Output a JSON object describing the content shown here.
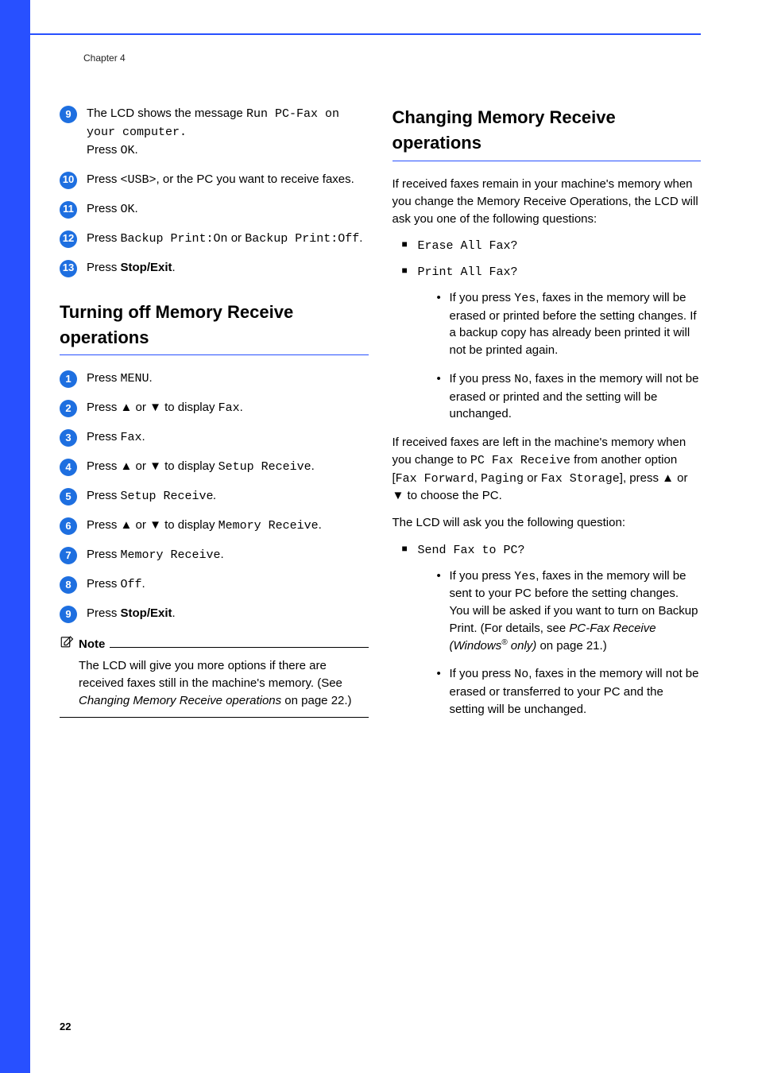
{
  "chapterLabel": "Chapter 4",
  "pageNumber": "22",
  "left": {
    "steps9_13": {
      "s9_a": "The LCD shows the message",
      "s9_run": "Run PC-Fax on your computer.",
      "s9_b": "Press ",
      "s9_ok": "OK",
      "s10_a": "Press ",
      "s10_usb": "<USB>",
      "s10_b": ", or the PC you want to receive faxes.",
      "s11_a": "Press ",
      "s11_ok": "OK",
      "s12_a": "Press ",
      "s12_on": "Backup Print:On",
      "s12_b": " or ",
      "s12_off": "Backup Print:Off",
      "s13_a": "Press ",
      "s13_stop": "Stop/Exit"
    },
    "title1": "Turning off Memory Receive operations",
    "steps1_9": {
      "s1_a": "Press ",
      "s1_menu": "MENU",
      "s2_a": "Press ",
      "s2_b": " or ",
      "s2_c": " to display ",
      "s2_fax": "Fax",
      "s3_a": "Press ",
      "s3_fax": "Fax",
      "s4_a": "Press ",
      "s4_b": " or ",
      "s4_c": " to display ",
      "s4_setup": "Setup Receive",
      "s5_a": "Press ",
      "s5_setup": "Setup Receive",
      "s6_a": "Press ",
      "s6_b": " or ",
      "s6_c": " to display ",
      "s6_mem": "Memory Receive",
      "s7_a": "Press ",
      "s7_mem": "Memory Receive",
      "s8_a": "Press ",
      "s8_off": "Off",
      "s9b_a": "Press ",
      "s9b_stop": "Stop/Exit"
    },
    "note": {
      "title": "Note",
      "body_a": "The LCD will give you more options if there are received faxes still in the machine's memory. (See ",
      "body_link": "Changing Memory Receive operations",
      "body_b": " on page 22.)"
    }
  },
  "right": {
    "title": "Changing Memory Receive operations",
    "intro": "If received faxes remain in your machine's memory when you change the Memory Receive Operations, the LCD will ask you one of the following questions:",
    "sq1": "Erase All Fax?",
    "sq2": "Print All Fax?",
    "b1_a": "If you press ",
    "b1_yes": "Yes",
    "b1_b": ", faxes in the memory will be erased or printed before the setting changes. If a backup copy has already been printed it will not be printed again.",
    "b2_a": "If you press ",
    "b2_no": "No",
    "b2_b": ", faxes in the memory will not be erased or printed and the setting will be unchanged.",
    "mid_a": "If received faxes are left in the machine's memory when you change to ",
    "mid_pc": "PC Fax Receive",
    "mid_b": " from another option ",
    "mid_opt1": "Fax Forward",
    "mid_opt2": "Paging",
    "mid_or": " or ",
    "mid_opt3": "Fax Storage",
    "mid_c": "], press ",
    "mid_d": " or ",
    "mid_e": " to choose the PC.",
    "q_intro": "The LCD will ask you the following question:",
    "sq3": "Send Fax to PC?",
    "b3_a": "If you press ",
    "b3_yes": "Yes",
    "b3_b": ", faxes in the memory will be sent to your PC before the setting changes. You will be asked if you want to turn on Backup Print. (For details, see ",
    "b3_link": "PC-Fax Receive (Windows",
    "b3_only": " only)",
    "b3_c": " on page 21.)",
    "b4_a": "If you press ",
    "b4_no": "No",
    "b4_b": ", faxes in the memory will not be erased or transferred to your PC and the setting will be unchanged."
  },
  "badges": {
    "n1": "1",
    "n2": "2",
    "n3": "3",
    "n4": "4",
    "n5": "5",
    "n6": "6",
    "n7": "7",
    "n8": "8",
    "n9": "9",
    "n10": "10",
    "n11": "11",
    "n12": "12",
    "n13": "13"
  },
  "symbols": {
    "up": "▲",
    "down": "▼",
    "regmark": "®"
  }
}
